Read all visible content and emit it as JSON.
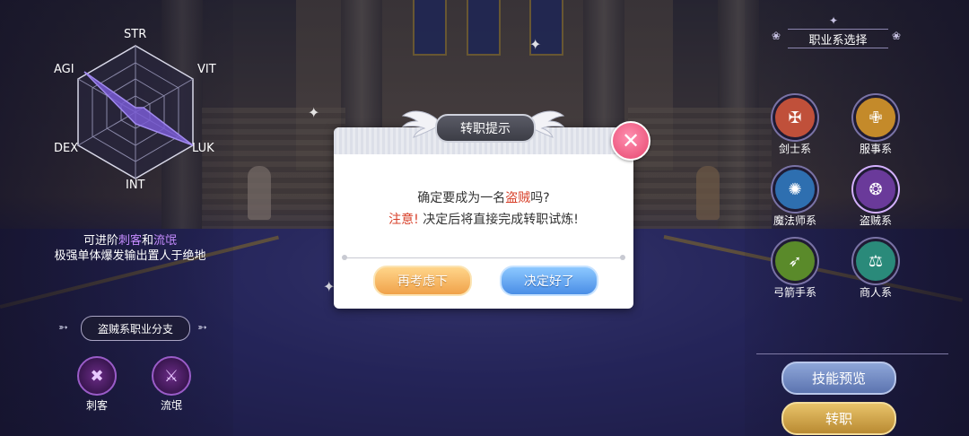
{
  "stats": {
    "str": "STR",
    "vit": "VIT",
    "luk": "LUK",
    "int": "INT",
    "dex": "DEX",
    "agi": "AGI"
  },
  "advance": {
    "prefix": "可进阶",
    "job_a": "刺客",
    "and": "和",
    "job_b": "流氓",
    "desc": "极强单体爆发输出置人于绝地"
  },
  "branch_section": {
    "title": "盗贼系职业分支",
    "items": [
      {
        "label": "刺客"
      },
      {
        "label": "流氓"
      }
    ]
  },
  "class_panel": {
    "title": "职业系选择",
    "classes": [
      {
        "label": "剑士系",
        "color": "#c0503a"
      },
      {
        "label": "服事系",
        "color": "#c48a2a"
      },
      {
        "label": "魔法师系",
        "color": "#2e6fb0"
      },
      {
        "label": "盗贼系",
        "color": "#6a3a9a"
      },
      {
        "label": "弓箭手系",
        "color": "#5a8a2a"
      },
      {
        "label": "商人系",
        "color": "#2a8a7a"
      }
    ],
    "skill_preview": "技能预览",
    "change_job": "转职"
  },
  "dialog": {
    "title": "转职提示",
    "msg_prefix": "确定要成为一名",
    "msg_job": "盗贼",
    "msg_suffix": "吗?",
    "warn_label": "注意!",
    "warn_text": "决定后将直接完成转职试炼!",
    "cancel": "再考虑下",
    "confirm": "决定好了"
  },
  "colors": {
    "accent_red": "#d8402a",
    "thief_purple": "#6a3a9a"
  }
}
